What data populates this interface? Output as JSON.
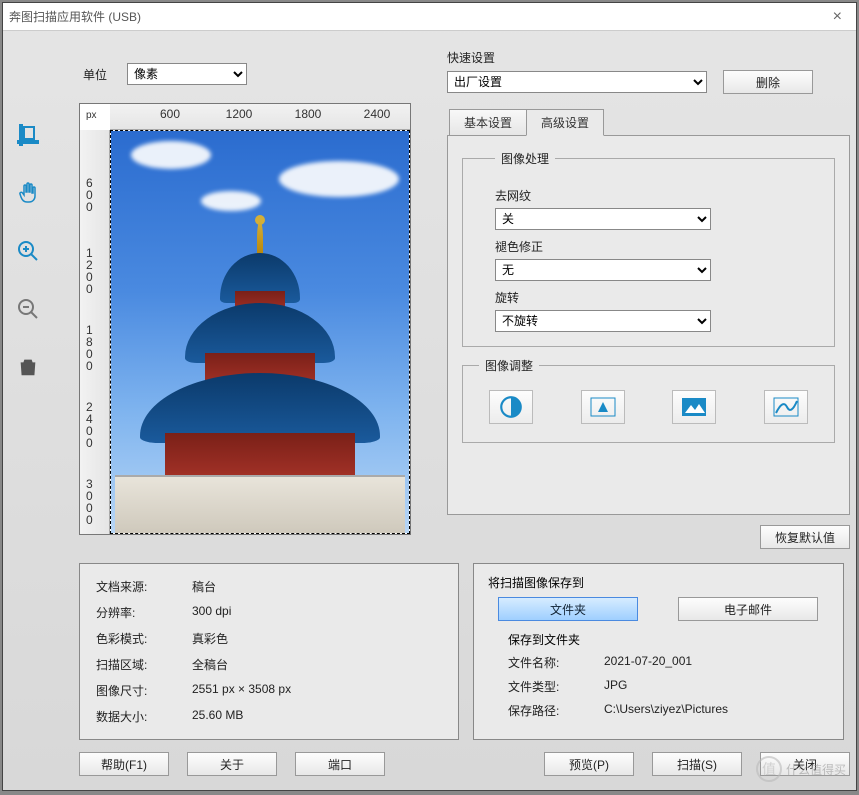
{
  "window": {
    "title": "奔图扫描应用软件 (USB)"
  },
  "unit": {
    "label": "单位",
    "value": "像素"
  },
  "preview": {
    "px_label": "px",
    "h_ticks": [
      "600",
      "1200",
      "1800",
      "2400"
    ],
    "v_ticks": [
      "600",
      "1200",
      "1800",
      "2400",
      "3000"
    ]
  },
  "quick": {
    "label": "快速设置",
    "value": "出厂设置",
    "delete_btn": "删除"
  },
  "tabs": {
    "basic": "基本设置",
    "advanced": "高级设置"
  },
  "img_proc": {
    "legend": "图像处理",
    "descreen_label": "去网纹",
    "descreen_value": "关",
    "fade_label": "褪色修正",
    "fade_value": "无",
    "rotate_label": "旋转",
    "rotate_value": "不旋转"
  },
  "img_adjust": {
    "legend": "图像调整"
  },
  "restore_btn": "恢复默认值",
  "info": {
    "source_label": "文档来源:",
    "source_value": "稿台",
    "dpi_label": "分辨率:",
    "dpi_value": "300 dpi",
    "color_label": "色彩模式:",
    "color_value": "真彩色",
    "area_label": "扫描区域:",
    "area_value": "全稿台",
    "size_label": "图像尺寸:",
    "size_value": "2551 px × 3508 px",
    "data_label": "数据大小:",
    "data_value": "25.60 MB"
  },
  "save": {
    "title": "将扫描图像保存到",
    "folder_btn": "文件夹",
    "email_btn": "电子邮件",
    "subtitle": "保存到文件夹",
    "name_label": "文件名称:",
    "name_value": "2021-07-20_001",
    "type_label": "文件类型:",
    "type_value": "JPG",
    "path_label": "保存路径:",
    "path_value": "C:\\Users\\ziyez\\Pictures"
  },
  "buttons": {
    "help": "帮助(F1)",
    "about": "关于",
    "port": "端口",
    "preview": "预览(P)",
    "scan": "扫描(S)",
    "close": "关闭"
  },
  "watermark": {
    "badge": "值",
    "text": "什么值得买"
  }
}
